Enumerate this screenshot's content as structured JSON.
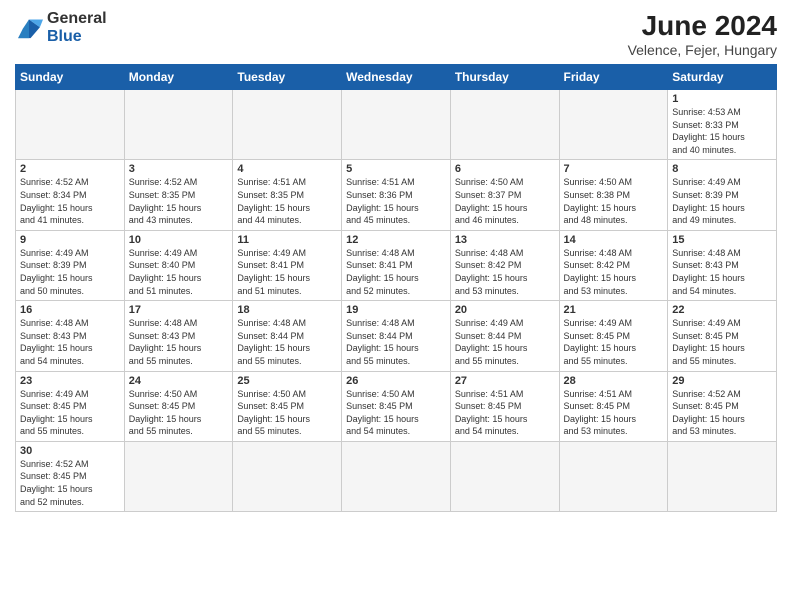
{
  "header": {
    "logo_general": "General",
    "logo_blue": "Blue",
    "title": "June 2024",
    "subtitle": "Velence, Fejer, Hungary"
  },
  "weekdays": [
    "Sunday",
    "Monday",
    "Tuesday",
    "Wednesday",
    "Thursday",
    "Friday",
    "Saturday"
  ],
  "weeks": [
    [
      {
        "day": "",
        "info": ""
      },
      {
        "day": "",
        "info": ""
      },
      {
        "day": "",
        "info": ""
      },
      {
        "day": "",
        "info": ""
      },
      {
        "day": "",
        "info": ""
      },
      {
        "day": "",
        "info": ""
      },
      {
        "day": "1",
        "info": "Sunrise: 4:53 AM\nSunset: 8:33 PM\nDaylight: 15 hours\nand 40 minutes."
      }
    ],
    [
      {
        "day": "2",
        "info": "Sunrise: 4:52 AM\nSunset: 8:34 PM\nDaylight: 15 hours\nand 41 minutes."
      },
      {
        "day": "3",
        "info": "Sunrise: 4:52 AM\nSunset: 8:35 PM\nDaylight: 15 hours\nand 43 minutes."
      },
      {
        "day": "4",
        "info": "Sunrise: 4:51 AM\nSunset: 8:35 PM\nDaylight: 15 hours\nand 44 minutes."
      },
      {
        "day": "5",
        "info": "Sunrise: 4:51 AM\nSunset: 8:36 PM\nDaylight: 15 hours\nand 45 minutes."
      },
      {
        "day": "6",
        "info": "Sunrise: 4:50 AM\nSunset: 8:37 PM\nDaylight: 15 hours\nand 46 minutes."
      },
      {
        "day": "7",
        "info": "Sunrise: 4:50 AM\nSunset: 8:38 PM\nDaylight: 15 hours\nand 48 minutes."
      },
      {
        "day": "8",
        "info": "Sunrise: 4:49 AM\nSunset: 8:39 PM\nDaylight: 15 hours\nand 49 minutes."
      }
    ],
    [
      {
        "day": "9",
        "info": "Sunrise: 4:49 AM\nSunset: 8:39 PM\nDaylight: 15 hours\nand 50 minutes."
      },
      {
        "day": "10",
        "info": "Sunrise: 4:49 AM\nSunset: 8:40 PM\nDaylight: 15 hours\nand 51 minutes."
      },
      {
        "day": "11",
        "info": "Sunrise: 4:49 AM\nSunset: 8:41 PM\nDaylight: 15 hours\nand 51 minutes."
      },
      {
        "day": "12",
        "info": "Sunrise: 4:48 AM\nSunset: 8:41 PM\nDaylight: 15 hours\nand 52 minutes."
      },
      {
        "day": "13",
        "info": "Sunrise: 4:48 AM\nSunset: 8:42 PM\nDaylight: 15 hours\nand 53 minutes."
      },
      {
        "day": "14",
        "info": "Sunrise: 4:48 AM\nSunset: 8:42 PM\nDaylight: 15 hours\nand 53 minutes."
      },
      {
        "day": "15",
        "info": "Sunrise: 4:48 AM\nSunset: 8:43 PM\nDaylight: 15 hours\nand 54 minutes."
      }
    ],
    [
      {
        "day": "16",
        "info": "Sunrise: 4:48 AM\nSunset: 8:43 PM\nDaylight: 15 hours\nand 54 minutes."
      },
      {
        "day": "17",
        "info": "Sunrise: 4:48 AM\nSunset: 8:43 PM\nDaylight: 15 hours\nand 55 minutes."
      },
      {
        "day": "18",
        "info": "Sunrise: 4:48 AM\nSunset: 8:44 PM\nDaylight: 15 hours\nand 55 minutes."
      },
      {
        "day": "19",
        "info": "Sunrise: 4:48 AM\nSunset: 8:44 PM\nDaylight: 15 hours\nand 55 minutes."
      },
      {
        "day": "20",
        "info": "Sunrise: 4:49 AM\nSunset: 8:44 PM\nDaylight: 15 hours\nand 55 minutes."
      },
      {
        "day": "21",
        "info": "Sunrise: 4:49 AM\nSunset: 8:45 PM\nDaylight: 15 hours\nand 55 minutes."
      },
      {
        "day": "22",
        "info": "Sunrise: 4:49 AM\nSunset: 8:45 PM\nDaylight: 15 hours\nand 55 minutes."
      }
    ],
    [
      {
        "day": "23",
        "info": "Sunrise: 4:49 AM\nSunset: 8:45 PM\nDaylight: 15 hours\nand 55 minutes."
      },
      {
        "day": "24",
        "info": "Sunrise: 4:50 AM\nSunset: 8:45 PM\nDaylight: 15 hours\nand 55 minutes."
      },
      {
        "day": "25",
        "info": "Sunrise: 4:50 AM\nSunset: 8:45 PM\nDaylight: 15 hours\nand 55 minutes."
      },
      {
        "day": "26",
        "info": "Sunrise: 4:50 AM\nSunset: 8:45 PM\nDaylight: 15 hours\nand 54 minutes."
      },
      {
        "day": "27",
        "info": "Sunrise: 4:51 AM\nSunset: 8:45 PM\nDaylight: 15 hours\nand 54 minutes."
      },
      {
        "day": "28",
        "info": "Sunrise: 4:51 AM\nSunset: 8:45 PM\nDaylight: 15 hours\nand 53 minutes."
      },
      {
        "day": "29",
        "info": "Sunrise: 4:52 AM\nSunset: 8:45 PM\nDaylight: 15 hours\nand 53 minutes."
      }
    ],
    [
      {
        "day": "30",
        "info": "Sunrise: 4:52 AM\nSunset: 8:45 PM\nDaylight: 15 hours\nand 52 minutes."
      },
      {
        "day": "",
        "info": ""
      },
      {
        "day": "",
        "info": ""
      },
      {
        "day": "",
        "info": ""
      },
      {
        "day": "",
        "info": ""
      },
      {
        "day": "",
        "info": ""
      },
      {
        "day": "",
        "info": ""
      }
    ]
  ]
}
